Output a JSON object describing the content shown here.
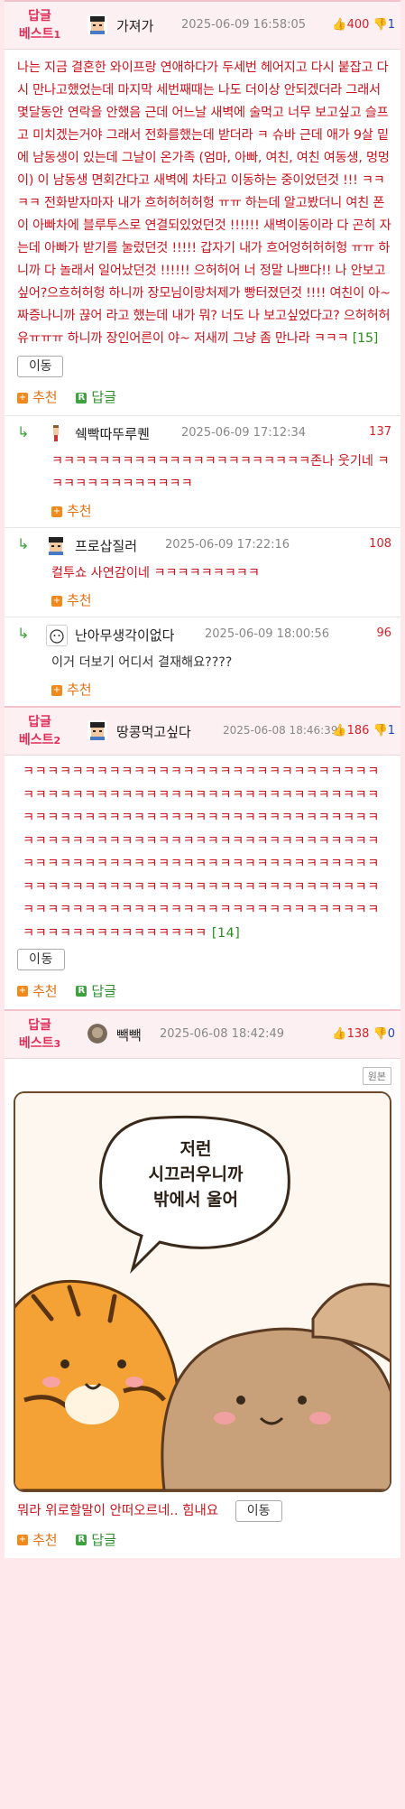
{
  "best1": {
    "label": "답글",
    "label2": "베스트",
    "num": "1",
    "nick": "가져가",
    "date": "2025-06-09 16:58:05",
    "up": "400",
    "down": "1",
    "text": "나는 지금 결혼한 와이프랑 연애하다가 두세번 헤어지고 다시 붙잡고 다시 만나고했었는데 마지막 세번째때는 나도 더이상 안되겠더라 그래서 몇달동안 연락을 안했음 근데 어느날 새벽에 술먹고 너무 보고싶고 슬프고 미치겠는거야 그래서 전화를했는데 받더라 ㅋ 슈바 근데 애가 9살 밑에 남동생이 있는데 그날이 온가족 (엄마, 아빠, 여친, 여친 여동생, 멍멍이) 이 남동생 면회간다고 새벽에 차타고 이동하는 중이었던것 !!! ㅋㅋㅋㅋ 전화받자마자 내가 흐허허허허헝 ㅠㅠ 하는데 알고봤더니 여친 폰이 아빠차에 블루투스로 연결되있었던것 !!!!!! 새벽이동이라 다 곤히 자는데 아빠가 받기를 눌렀던것 !!!!! 갑자기 내가 흐어엉허허허헝 ㅠㅠ 하니까 다 놀래서 일어났던것 !!!!!! 으허허어 너 정말 나쁘다!! 나 안보고 싶어?으흐허허헝 하니까 장모님이랑처제가 빵터졌던것 !!!! 여친이 아~ 짜증나니까 끊어 라고 했는데 내가 뭐? 너도 나 보고싶었다고? 으허허허유ㅠㅠㅠ 하니까 장인어른이 야~ 저새끼 그냥 좀 만나라 ㅋㅋㅋ",
    "count": "[15]",
    "move": "이동",
    "recommend": "추천",
    "reply": "답글",
    "replies": [
      {
        "nick": "쉑빡따뚜루퀜",
        "date": "2025-06-09 17:12:34",
        "score": "137",
        "text": "ㅋㅋㅋㅋㅋㅋㅋㅋㅋㅋㅋㅋㅋㅋㅋㅋㅋㅋㅋㅋㅋㅋ존나 웃기네 ㅋㅋㅋㅋㅋㅋㅋㅋㅋㅋㅋㅋㅋ",
        "recommend": "추천"
      },
      {
        "nick": "프로삽질러",
        "date": "2025-06-09 17:22:16",
        "score": "108",
        "text": "컬투쇼 사연감이네 ㅋㅋㅋㅋㅋㅋㅋㅋㅋ",
        "recommend": "추천"
      },
      {
        "nick": "난아무생각이없다",
        "date": "2025-06-09 18:00:56",
        "score": "96",
        "text": "이거 더보기 어디서 결재해요????",
        "recommend": "추천"
      }
    ]
  },
  "best2": {
    "label": "답글",
    "label2": "베스트",
    "num": "2",
    "nick": "땅콩먹고싶다",
    "date": "2025-06-08 18:46:39",
    "up": "186",
    "down": "1",
    "text": "ㅋㅋㅋㅋㅋㅋㅋㅋㅋㅋㅋㅋㅋㅋㅋㅋㅋㅋㅋㅋㅋㅋㅋㅋㅋㅋㅋㅋㅋㅋㅋㅋㅋㅋㅋㅋㅋㅋㅋㅋㅋㅋㅋㅋㅋㅋㅋㅋㅋㅋㅋㅋㅋㅋㅋㅋㅋㅋㅋㅋㅋㅋㅋㅋㅋㅋㅋㅋㅋㅋㅋㅋㅋㅋㅋㅋㅋㅋㅋㅋㅋㅋㅋㅋㅋㅋㅋㅋㅋㅋㅋㅋㅋㅋㅋㅋㅋㅋㅋㅋㅋㅋㅋㅋㅋㅋㅋㅋㅋㅋㅋㅋㅋㅋㅋㅋㅋㅋㅋㅋㅋㅋㅋㅋㅋㅋㅋㅋㅋㅋㅋㅋㅋㅋㅋㅋㅋㅋㅋㅋㅋㅋㅋㅋㅋㅋㅋㅋㅋㅋㅋㅋㅋㅋㅋㅋㅋㅋㅋㅋㅋㅋㅋㅋㅋㅋㅋㅋㅋㅋㅋㅋㅋㅋㅋㅋㅋㅋㅋㅋㅋㅋㅋㅋㅋㅋㅋㅋㅋㅋㅋㅋㅋㅋㅋㅋㅋㅋㅋㅋㅋㅋㅋㅋㅋㅋㅋㅋㅋㅋㅋㅋㅋㅋㅋㅋㅋㅋ",
    "count": "[14]",
    "move": "이동",
    "recommend": "추천",
    "reply": "답글"
  },
  "best3": {
    "label": "답글",
    "label2": "베스트",
    "num": "3",
    "nick": "빽빽",
    "date": "2025-06-08 18:42:49",
    "up": "138",
    "down": "0",
    "original": "원본",
    "speech": [
      "저런",
      "시끄러우니까",
      "밖에서 울어"
    ],
    "text": "뭐라 위로할말이 안떠오르네.. 힘내요",
    "move": "이동",
    "recommend": "추천",
    "reply": "답글"
  }
}
